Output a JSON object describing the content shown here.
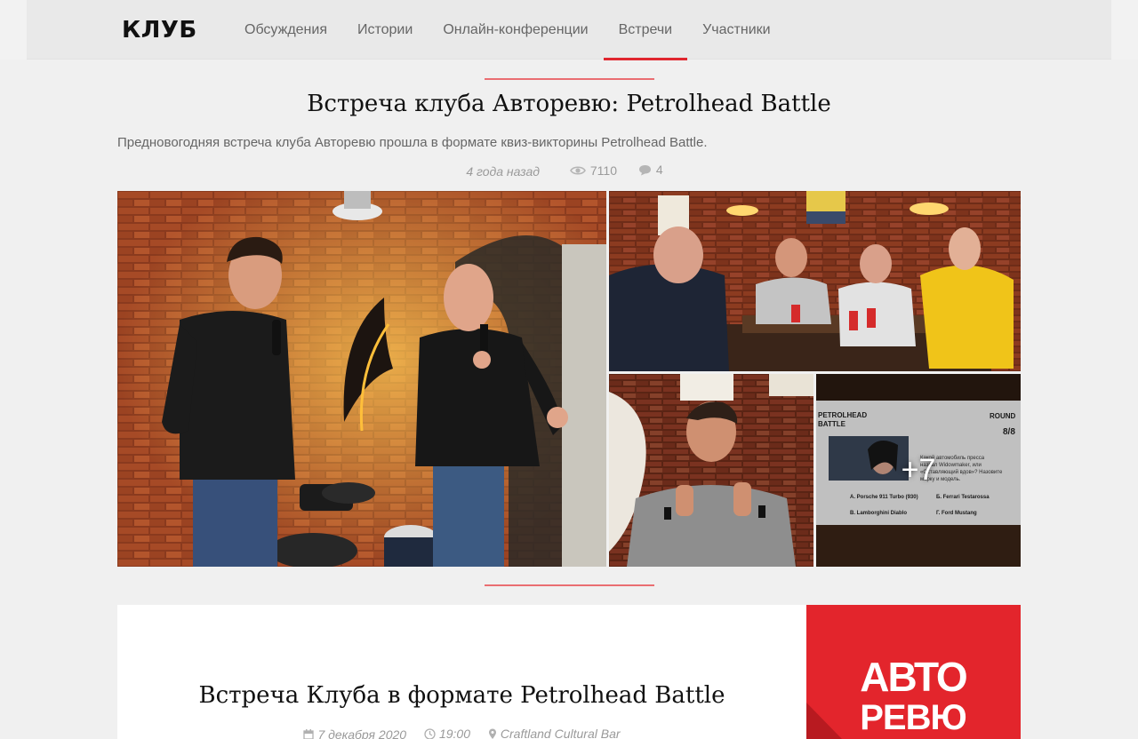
{
  "header": {
    "logo": "КЛУБ",
    "nav": [
      {
        "label": "Обсуждения",
        "active": false
      },
      {
        "label": "Истории",
        "active": false
      },
      {
        "label": "Онлайн-конференции",
        "active": false
      },
      {
        "label": "Встречи",
        "active": true
      },
      {
        "label": "Участники",
        "active": false
      }
    ]
  },
  "post": {
    "title": "Встреча клуба Авторевю: Petrolhead Battle",
    "description": "Предновогодняя встреча клуба Авторевю прошла в формате квиз-викторины Petrolhead Battle.",
    "age": "4 года назад",
    "views": "7110",
    "comments": "4"
  },
  "gallery": {
    "more_label": "+7",
    "screen": {
      "brand_line1": "PETROLHEAD",
      "brand_line2": "BATTLE",
      "round_label": "ROUND",
      "round_value": "8/8",
      "question": "Какой автомобиль пресса назвал Widowmaker, или «Оставляющий вдов»? Назовите марку и модель.",
      "answers": [
        "A. Porsche 911 Turbo (930)",
        "Б. Ferrari Testarossa",
        "B. Lamborghini Diablo",
        "Г. Ford Mustang"
      ]
    }
  },
  "event": {
    "title": "Встреча Клуба в формате Petrolhead Battle",
    "date": "7 декабря 2020",
    "time": "19:00",
    "place": "Craftland Cultural Bar",
    "brand_line1": "АВТО",
    "brand_line2": "РЕВЮ"
  },
  "colors": {
    "accent": "#e0262f",
    "brand_red": "#e3252c"
  }
}
